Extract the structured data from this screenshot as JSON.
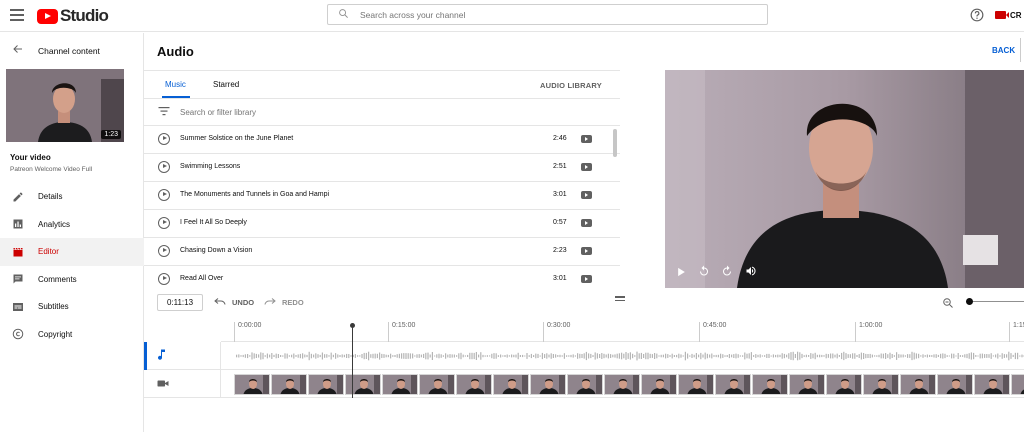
{
  "app": {
    "logo_text": "Studio"
  },
  "topbar": {
    "search_placeholder": "Search across your channel",
    "create_label": "CR"
  },
  "sidebar": {
    "back_label": "Channel content",
    "thumbnail_duration": "1:23",
    "your_video_label": "Your video",
    "video_name": "Patreon Welcome Video Full",
    "items": [
      {
        "label": "Details",
        "icon": "pencil-icon",
        "active": false
      },
      {
        "label": "Analytics",
        "icon": "analytics-icon",
        "active": false
      },
      {
        "label": "Editor",
        "icon": "editor-icon",
        "active": true
      },
      {
        "label": "Comments",
        "icon": "comments-icon",
        "active": false
      },
      {
        "label": "Subtitles",
        "icon": "subtitles-icon",
        "active": false
      },
      {
        "label": "Copyright",
        "icon": "copyright-icon",
        "active": false
      }
    ]
  },
  "main": {
    "title": "Audio",
    "back_button": "BACK"
  },
  "audio": {
    "tabs": [
      {
        "label": "Music",
        "active": true
      },
      {
        "label": "Starred",
        "active": false
      }
    ],
    "library_button": "AUDIO LIBRARY",
    "filter_placeholder": "Search or filter library",
    "tracks": [
      {
        "name": "Summer Solstice on the June Planet",
        "duration": "2:46"
      },
      {
        "name": "Swimming Lessons",
        "duration": "2:51"
      },
      {
        "name": "The Monuments and Tunnels in Goa and Hampi",
        "duration": "3:01"
      },
      {
        "name": "I Feel It All So Deeply",
        "duration": "0:57"
      },
      {
        "name": "Chasing Down a Vision",
        "duration": "2:23"
      },
      {
        "name": "Read All Over",
        "duration": "3:01"
      }
    ]
  },
  "timeline": {
    "current_time": "0:11:13",
    "undo_label": "UNDO",
    "redo_label": "REDO",
    "ruler_ticks": [
      "0:00:00",
      "0:15:00",
      "0:30:00",
      "0:45:00",
      "1:00:00",
      "1:15"
    ]
  },
  "colors": {
    "accent_blue": "#065fd4",
    "brand_red": "#ff0000",
    "active_red": "#cc0000"
  }
}
